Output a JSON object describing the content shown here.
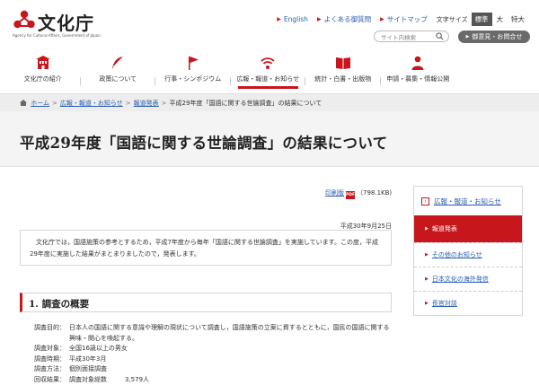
{
  "header": {
    "logo_text": "文化庁",
    "logo_sub": "Agency for Cultural Affairs, Government of Japan",
    "links": [
      {
        "label": "English"
      },
      {
        "label": "よくある御質問"
      },
      {
        "label": "サイトマップ"
      }
    ],
    "font_size_label": "文字サイズ",
    "font_sizes": [
      {
        "label": "標準",
        "active": true
      },
      {
        "label": "大",
        "active": false
      },
      {
        "label": "特大",
        "active": false
      }
    ],
    "search_placeholder": "サイト内検索",
    "opinion_button": "御意見・お問合せ"
  },
  "gnav": [
    {
      "label": "文化庁の紹介",
      "icon": "building-icon"
    },
    {
      "label": "政策について",
      "icon": "feather-icon"
    },
    {
      "label": "行事・シンポジウム",
      "icon": "flag-icon"
    },
    {
      "label": "広報・報道・お知らせ",
      "icon": "broadcast-icon",
      "active": true
    },
    {
      "label": "統計・白書・出版物",
      "icon": "book-icon"
    },
    {
      "label": "申請・募集・情報公開",
      "icon": "person-icon"
    }
  ],
  "breadcrumb": {
    "items": [
      "ホーム",
      "広報・報道・お知らせ",
      "報道発表"
    ],
    "current": "平成29年度「国語に関する世論調査」の結果について"
  },
  "page_title": "平成29年度「国語に関する世論調査」の結果について",
  "pdf": {
    "link_label": "印刷版",
    "mark": "PDF",
    "size": "（798.1KB)"
  },
  "date": "平成30年9月25日",
  "intro": "文化庁では，国語施策の参考とするため，平成7年度から毎年「国語に関する世論調査」を実施しています。この度，平成29年度に実施した結果がまとまりましたので，発表します。",
  "section1": {
    "heading": "1. 調査の概要",
    "rows": [
      {
        "label": "調査目的：",
        "value": "日本人の国語に関する意識や理解の現状について調査し，国語施策の立案に資するとともに，国民の国語に関する興味・関心を喚起する。"
      },
      {
        "label": "調査対象：",
        "value": "全国16歳以上の男女"
      },
      {
        "label": "調査時期：",
        "value": "平成30年3月"
      },
      {
        "label": "調査方法：",
        "value": "個別面接調査"
      },
      {
        "label": "回収結果：",
        "value": "調査対象総数",
        "num": "3,579人"
      }
    ]
  },
  "sidebar": {
    "heading": "広報・報道・お知らせ",
    "items": [
      {
        "label": "報道発表",
        "active": true
      },
      {
        "label": "その他のお知らせ",
        "active": false
      },
      {
        "label": "日本文化の海外発信",
        "active": false
      },
      {
        "label": "長官対談",
        "active": false
      }
    ]
  },
  "colors": {
    "accent": "#c8161d",
    "link": "#2a5db0",
    "band": "#f4f4f4"
  }
}
